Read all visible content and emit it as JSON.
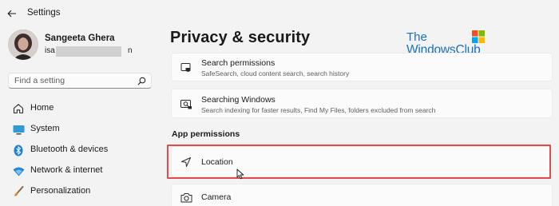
{
  "app": {
    "title": "Settings"
  },
  "user": {
    "name": "Sangeeta Ghera",
    "email_start": "isa",
    "email_end": "n"
  },
  "search": {
    "placeholder": "Find a setting"
  },
  "nav": [
    {
      "label": "Home",
      "icon": "home-icon"
    },
    {
      "label": "System",
      "icon": "system-icon"
    },
    {
      "label": "Bluetooth & devices",
      "icon": "bluetooth-icon"
    },
    {
      "label": "Network & internet",
      "icon": "network-icon"
    },
    {
      "label": "Personalization",
      "icon": "personalization-icon"
    }
  ],
  "main": {
    "title": "Privacy & security",
    "cards": [
      {
        "title": "Search permissions",
        "subtitle": "SafeSearch, cloud content search, search history",
        "icon": "search-permissions-icon"
      },
      {
        "title": "Searching Windows",
        "subtitle": "Search indexing for faster results, Find My Files, folders excluded from search",
        "icon": "searching-windows-icon"
      }
    ],
    "section": "App permissions",
    "permissions": [
      {
        "title": "Location",
        "icon": "location-icon"
      },
      {
        "title": "Camera",
        "icon": "camera-icon"
      }
    ]
  },
  "watermark": {
    "line1": "The",
    "line2": "WindowsClub"
  },
  "colors": {
    "accent": "#0067c0",
    "highlight": "#e14a4f",
    "watermark": "#1a6fc4"
  }
}
